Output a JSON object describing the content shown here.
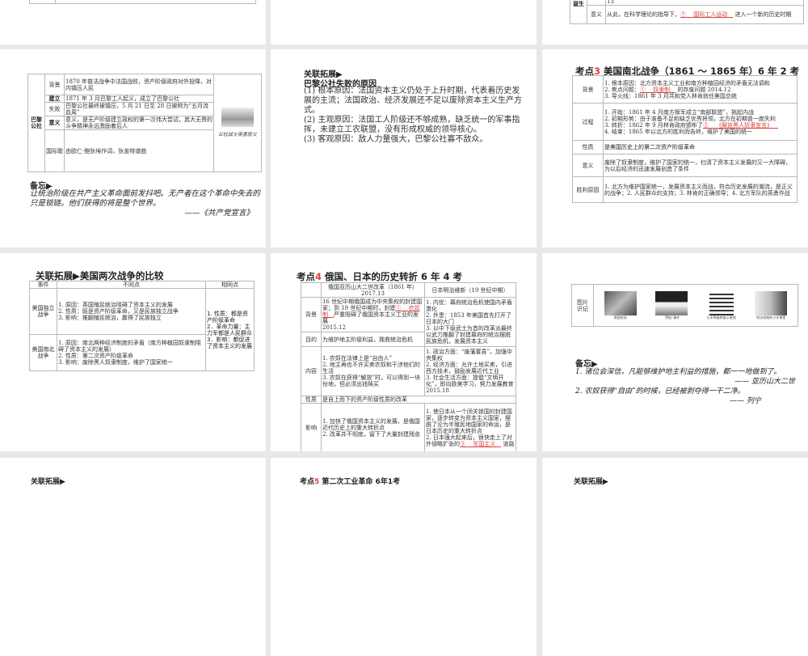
{
  "row1_right": {
    "group_label": "诞生",
    "prev_text": "13",
    "row_label": "意义",
    "line": [
      "从此，在科学理论的指导下，",
      {
        "r": "⑦ __国际工人运动__"
      },
      " 进入一个新的历史时期"
    ]
  },
  "paris": {
    "name": "巴黎公社",
    "rows": [
      {
        "label": "背景",
        "text": "1870 年普法战争中法国战败，资产阶级政府对外投降，对内镇压人民"
      },
      {
        "label": "建立",
        "text": "1871 年 3 月巴黎工人起义，成立了巴黎公社"
      },
      {
        "label": "失败",
        "text": "巴黎公社最终被镇压，5 月 21 日至 28 日被称为“五月流血周”"
      },
      {
        "label": "意义",
        "text": "意义，是无产阶级建立政权的第一次伟大尝试，其大无畏的斗争精神永远激励着后人"
      },
      {
        "label": "国际歌",
        "text": "由欧仁·鲍狄埃作词，狄盖特谱曲"
      }
    ],
    "image_caption": "公社战士英勇就义"
  },
  "memo1": {
    "heading": "备忘▶",
    "text": "让统治阶级在共产主义革命面前发抖吧。无产者在这个革命中失去的只是锁链。他们获得的将是整个世界。",
    "source": "——《共产党宣言》"
  },
  "ext1": {
    "heading": "关联拓展▶",
    "subheading": "巴黎公社失败的原因",
    "items": [
      "(1) 根本原因：法国资本主义仍处于上升时期，代表着历史发展的主流；法国政治、经济发展还不足以废除资本主义生产方式。",
      "(2) 主观原因：法国工人阶级还不够成熟，缺乏统一的军事指挥，未建立工农联盟，没有形成权威的领导核心。",
      "(3) 客观原因：敌人力量强大，巴黎公社寡不敌众。"
    ]
  },
  "civil": {
    "prefix": "考点",
    "num": "3",
    "title": "美国南北战争（1861 ～ 1865 年）6 年 2 考",
    "rows": [
      {
        "label": "背景",
        "lines": [
          "1. 根本原因：北方资本主义工业和南方种植园经济的矛盾无法调和",
          [
            "2. 焦点问题：",
            {
              "r": "① __奴隶制__"
            },
            " 的存废问题  2014.12"
          ],
          "3. 导火线：1861 年 3 月共和党人林肯就任美国总统"
        ]
      },
      {
        "label": "过程",
        "lines": [
          "1. 开始：1861 年 4 月南方叛军成立“南部联盟”，挑起内战",
          "2. 初期形势：由于准备不足和缺乏优秀将领，北方在初期曾一度失利",
          [
            "3. 转折：1862 年 9 月林肯政府颁布了",
            {
              "r": "② __《解放黑人奴隶宣言》__"
            }
          ],
          "4. 结束：1865 年以北方的胜利而告终，维护了美国的统一"
        ]
      },
      {
        "label": "性质",
        "lines": [
          "是美国历史上的第二次资产阶级革命"
        ]
      },
      {
        "label": "意义",
        "lines": [
          "废除了奴隶制度，维护了国家的统一，扫清了资本主义发展的又一大障碍，为以后经济的迅速发展创造了条件"
        ]
      },
      {
        "label": "胜利原因",
        "lines": [
          "1. 北方为维护国家统一，发展资本主义而战，符合历史发展的潮流，是正义的战争；2. 人民群众的支持；3. 林肯的正确领导；4. 北方军队的英勇作战"
        ]
      }
    ]
  },
  "compare": {
    "title": "关联拓展▶美国两次战争的比较",
    "headers": [
      "事件",
      "不同点",
      "相同点"
    ],
    "rows": [
      {
        "event": "美国独立战争",
        "diffs": [
          "1. 原因：英国殖民统治阻碍了资本主义的发展",
          "2. 性质：既是资产阶级革命，又是民族独立战争",
          "3. 影响：推翻殖民统治，赢得了民族独立"
        ]
      },
      {
        "event": "美国南北战争",
        "diffs": [
          "1. 原因：南北两种经济制度的矛盾（南方种植园奴隶制阻碍了资本主义的发展）",
          "2. 性质：第二次资产阶级革命",
          "3. 影响：废除黑人奴隶制度，维护了国家统一"
        ]
      }
    ],
    "same": [
      "1. 性质：都是资产阶级革命",
      "2．革命力量：主力军都是人民群众",
      "3．影响：都促进了资本主义的发展"
    ]
  },
  "rj": {
    "prefix": "考点",
    "num": "4",
    "title": "俄国、日本的历史转折  6 年 4 考",
    "headers": [
      "俄国亚历山大二世改革（1861 年）2017.13",
      "日本明治维新（19 世纪中期）"
    ],
    "labels": [
      "背景",
      "目的",
      "内容",
      "性质",
      "影响"
    ],
    "bg_ru": [
      [
        "16 世纪中期俄国成为中央集权的封建国家；到 19 世纪中期时，封建",
        {
          "r": "① __农奴制__"
        },
        "严重阻碍了俄国资本主义工业的发展"
      ],
      "2015.12"
    ],
    "bg_jp": [
      "1. 内忧：幕府统治危机使国内矛盾激化",
      "2. 外患：1853 年美国首先打开了日本的大门",
      "3. 以中下级武士为首的改革派最终以武力推翻了封建幕府的统治摆脱民族危机，发展资本主义"
    ],
    "aim_ru": "为维护地主阶级利益，挽救统治危机",
    "content_ru": [
      "1. 农奴在法律上是“自由人”",
      "2. 地主再也不许买卖农奴和干涉他们的生活",
      "3. 农奴在获得“解放”时，可以得到一块份地，但必须出钱赎买"
    ],
    "content_jp": [
      "1. 政治方面：“废藩置县”，加强中央集权",
      "2. 经济方面：允许土地买卖，引进西方技术，鼓励发展近代工业",
      "3. 社会生活方面：提倡“文明开化”，即向欧美学习，努力发展教育  2015.18"
    ],
    "nature": "是自上而下的资产阶级性质的改革",
    "impact_ru": [
      "1. 加快了俄国资本主义的发展，是俄国近代历史上的重大转折点",
      "2. 改革并不彻底，留下了大量封建残余"
    ],
    "impact_jp": [
      "1. 使日本从一个闭关锁国的封建国家，逐步转变为资本主义国家，摆脱了沦为半殖民地国家的命运，是日本历史的重大转折点",
      [
        "2. 日本强大起来后，很快走上了对外侵略扩张的",
        {
          "r": "③ __军国主义__"
        },
        " 道路"
      ]
    ]
  },
  "pictures": {
    "label": "图片识记",
    "captions": [
      "俄国农奴",
      "“黑船”事件",
      "日本等级制度示意图",
      "明治初期的小学课堂"
    ]
  },
  "memo3": {
    "heading": "备忘▶",
    "lines": [
      "1. 诸位会深信，凡能够维护地主利益的措施，都一一地做到了。",
      "—— 亚历山大二世",
      "2. 农奴获得“自由”的时候，已经被剥夺得一干二净。",
      "—— 列宁"
    ]
  },
  "row4": {
    "left_heading": "关联拓展▶",
    "mid_prefix": "考点",
    "mid_num": "5",
    "mid_title": "第二次工业革命  6年1考",
    "right_heading": "关联拓展▶"
  }
}
